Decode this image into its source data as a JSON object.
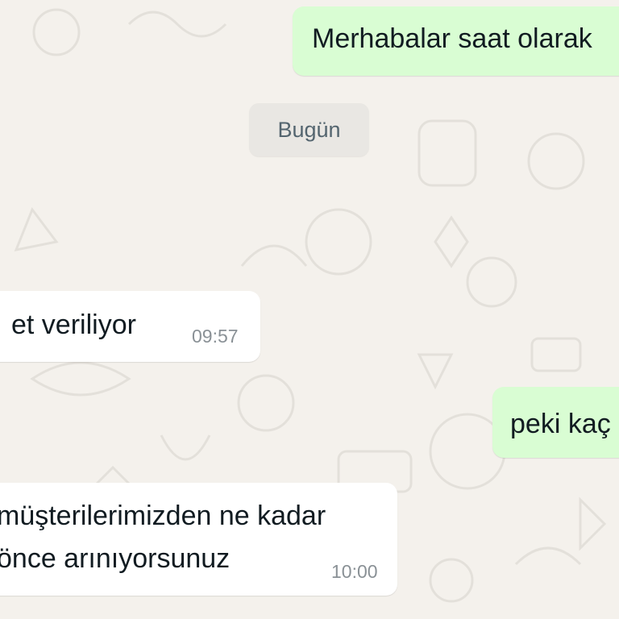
{
  "chat": {
    "date_separator": "Bugün",
    "messages": [
      {
        "direction": "out",
        "text": "Merhabalar saat olarak",
        "time": ""
      },
      {
        "direction": "in",
        "text": "et veriliyor",
        "time": "09:57"
      },
      {
        "direction": "out",
        "text": "peki kaç",
        "time": ""
      },
      {
        "direction": "in",
        "line1": "müşterilerimizden ne kadar",
        "line2": "önce arınıyorsunuz",
        "time": "10:00"
      }
    ]
  },
  "colors": {
    "wallpaper": "#f4f1ec",
    "outgoing_bubble": "#d9fdd3",
    "incoming_bubble": "#ffffff",
    "timestamp": "#8a9196"
  }
}
